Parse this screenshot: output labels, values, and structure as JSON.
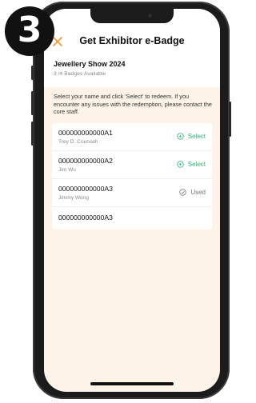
{
  "step_number": "3",
  "header": {
    "title": "Get Exhibitor e-Badge"
  },
  "event": {
    "name": "Jewellery Show 2024",
    "badges_available": "3 /4 Badges Available"
  },
  "instructions": "Select your name and click 'Select' to redeem. If you encounter any issues with the redemption, please contact the core staff.",
  "badges": [
    {
      "id": "000000000000A1",
      "owner": "Trey D. Counsell",
      "action": "Select",
      "status": "select"
    },
    {
      "id": "000000000000A2",
      "owner": "Jim Wu",
      "action": "Select",
      "status": "select"
    },
    {
      "id": "000000000000A3",
      "owner": "Jimmy Wong",
      "action": "Used",
      "status": "used"
    },
    {
      "id": "000000000000A3",
      "owner": "",
      "action": "",
      "status": "empty"
    }
  ],
  "colors": {
    "accent_orange": "#f29a3a",
    "select_green": "#2bb673",
    "used_gray": "#777777",
    "screen_background": "#fdf3e8"
  }
}
